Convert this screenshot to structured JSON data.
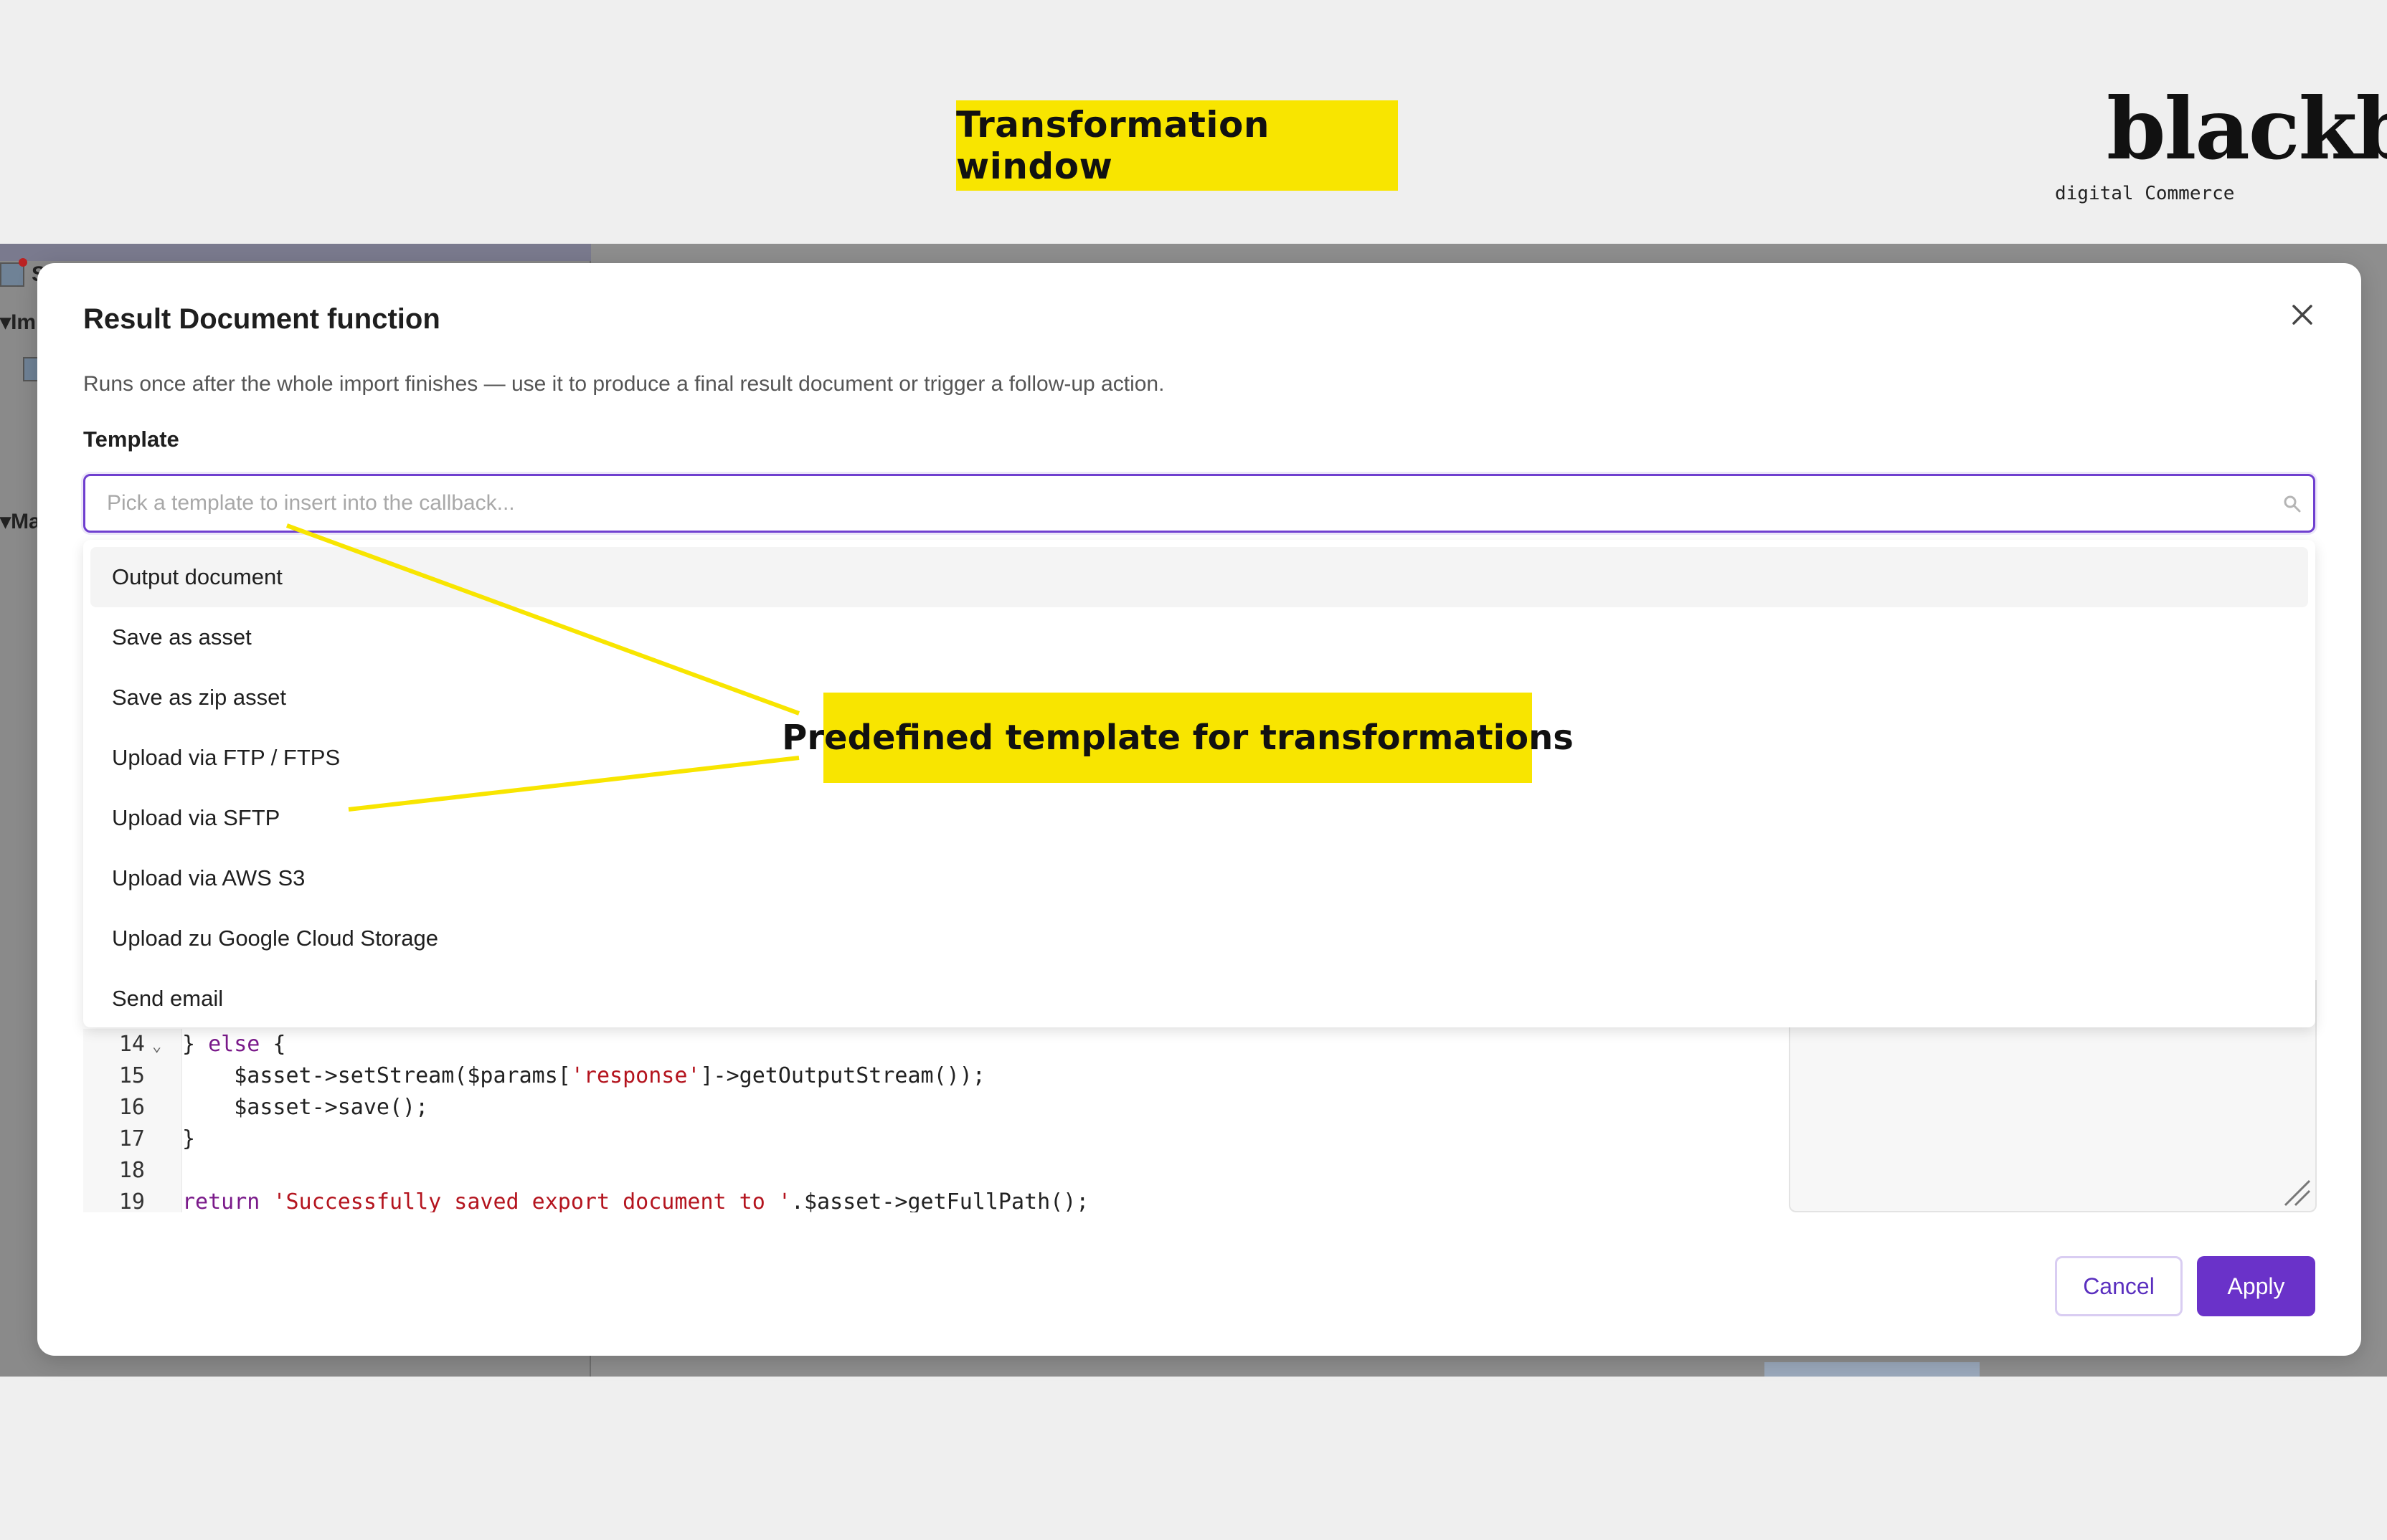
{
  "banner": {
    "title": "Transformation window"
  },
  "brand": {
    "logo_text": "blackbit",
    "subtitle": "digital Commerce"
  },
  "background_app": {
    "items": [
      "S",
      "Im",
      "Ma"
    ]
  },
  "modal": {
    "title": "Result Document function",
    "description": "Runs once after the whole import finishes — use it to produce a final result document or trigger a follow-up action.",
    "template_label": "Template",
    "search_placeholder": "Pick a template to insert into the callback...",
    "templates": [
      "Output document",
      "Save as asset",
      "Save as zip asset",
      "Upload via FTP / FTPS",
      "Upload via SFTP",
      "Upload via AWS S3",
      "Upload zu Google Cloud Storage",
      "Send email"
    ],
    "active_template": "Output document",
    "cancel_label": "Cancel",
    "apply_label": "Apply",
    "accent_color": "#6a32c9"
  },
  "editor": {
    "lines": [
      {
        "number": "14",
        "fold": "⌄",
        "code": [
          {
            "t": "} ",
            "c": ""
          },
          {
            "t": "else",
            "c": "kw"
          },
          {
            "t": " {",
            "c": ""
          }
        ]
      },
      {
        "number": "15",
        "fold": "",
        "code": [
          {
            "t": "    $asset->setStream($params[",
            "c": ""
          },
          {
            "t": "'response'",
            "c": "str"
          },
          {
            "t": "]->getOutputStream());",
            "c": ""
          }
        ]
      },
      {
        "number": "16",
        "fold": "",
        "code": [
          {
            "t": "    $asset->save();",
            "c": ""
          }
        ]
      },
      {
        "number": "17",
        "fold": "",
        "code": [
          {
            "t": "}",
            "c": ""
          }
        ]
      },
      {
        "number": "18",
        "fold": "",
        "code": [
          {
            "t": "",
            "c": ""
          }
        ]
      },
      {
        "number": "19",
        "fold": "",
        "code": [
          {
            "t": "return",
            "c": "kw"
          },
          {
            "t": " ",
            "c": ""
          },
          {
            "t": "'Successfully saved export document to '",
            "c": "str"
          },
          {
            "t": ".$asset->getFullPath();",
            "c": ""
          }
        ]
      }
    ]
  },
  "annotation": {
    "callout": "Predefined template for transformations",
    "color": "#f8e500"
  }
}
